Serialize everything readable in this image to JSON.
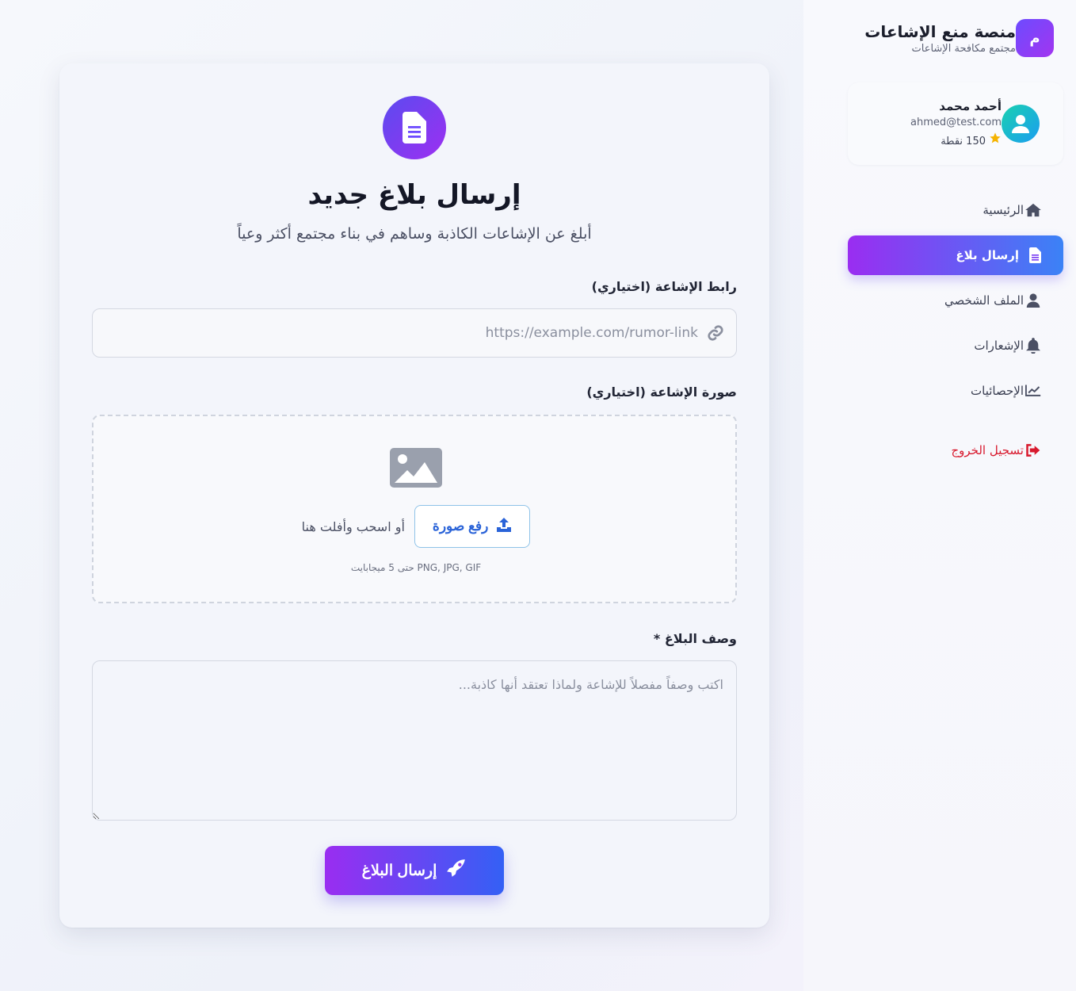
{
  "brand": {
    "logo_letter": "م",
    "title": "منصة منع الإشاعات",
    "subtitle": "مجتمع مكافحة الإشاعات"
  },
  "user": {
    "name": "أحمد محمد",
    "email": "ahmed@test.com",
    "points": "150 نقطة"
  },
  "nav": {
    "items": [
      {
        "label": "الرئيسية",
        "icon": "home-icon"
      },
      {
        "label": "إرسال بلاغ",
        "icon": "file-icon",
        "active": true
      },
      {
        "label": "الملف الشخصي",
        "icon": "user-icon"
      },
      {
        "label": "الإشعارات",
        "icon": "bell-icon"
      },
      {
        "label": "الإحصائيات",
        "icon": "chart-line-icon"
      }
    ],
    "logout": "تسجيل الخروج"
  },
  "form": {
    "title": "إرسال بلاغ جديد",
    "subtitle": "أبلغ عن الإشاعات الكاذبة وساهم في بناء مجتمع أكثر وعياً",
    "url_label": "رابط الإشاعة (اختياري)",
    "url_placeholder": "https://example.com/rumor-link",
    "image_label": "صورة الإشاعة (اختياري)",
    "upload_button": "رفع صورة",
    "drag_text": "أو اسحب وأفلت هنا",
    "upload_hint": "PNG, JPG, GIF حتى 5 ميجابايت",
    "desc_label": "وصف البلاغ *",
    "desc_placeholder": "اكتب وصفاً مفصلاً للإشاعة ولماذا تعتقد أنها كاذبة...",
    "submit": "إرسال البلاغ"
  },
  "colors": {
    "accent_start": "#9a2df1",
    "accent_end": "#3b82f6",
    "logout": "#d8192d",
    "star": "#f5b301"
  }
}
